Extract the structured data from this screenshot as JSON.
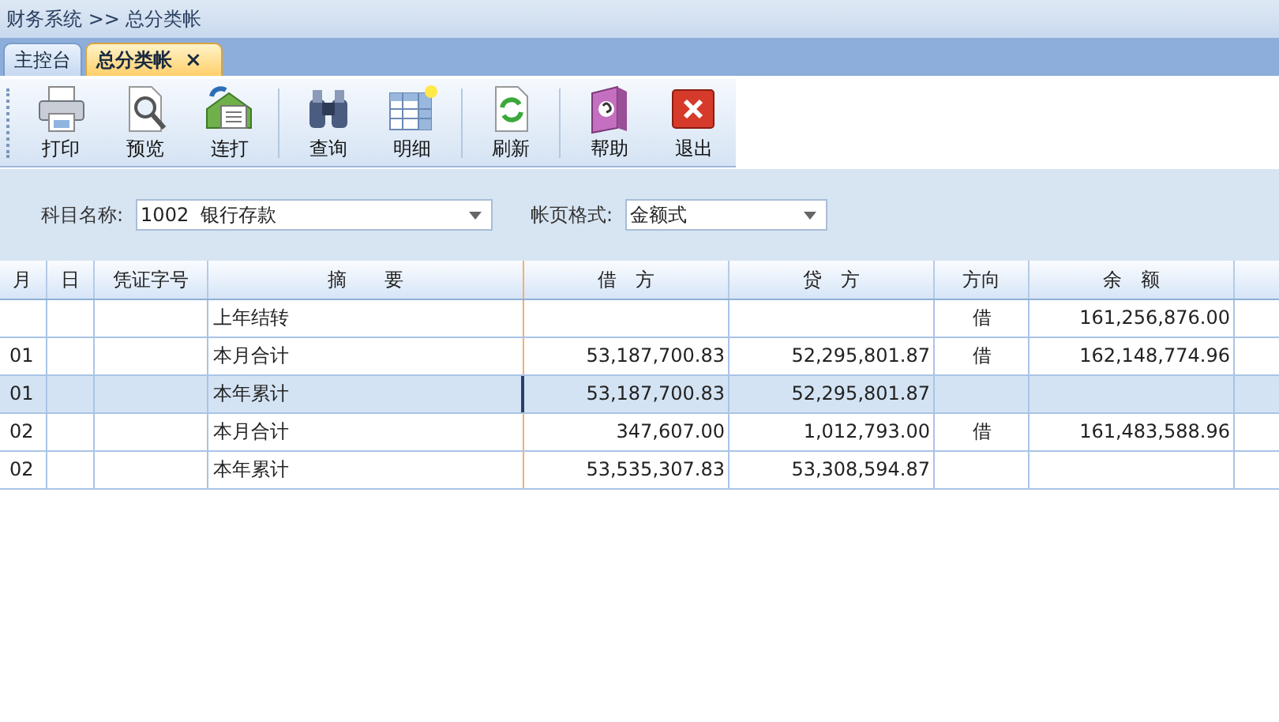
{
  "breadcrumb": "财务系统 >> 总分类帐",
  "tabs": [
    {
      "label": "主控台",
      "selected": false
    },
    {
      "label": "总分类帐",
      "selected": true,
      "close": "×"
    }
  ],
  "toolbar": {
    "groups": [
      [
        {
          "label": "打印"
        },
        {
          "label": "预览"
        },
        {
          "label": "连打"
        }
      ],
      [
        {
          "label": "查询"
        },
        {
          "label": "明细"
        }
      ],
      [
        {
          "label": "刷新"
        }
      ],
      [
        {
          "label": "帮助"
        },
        {
          "label": "退出"
        }
      ]
    ]
  },
  "filters": [
    {
      "label": "科目名称:",
      "value": "1002  银行存款"
    },
    {
      "label": "帐页格式:",
      "value": "金额式"
    }
  ],
  "table": {
    "columns": [
      {
        "label": "月"
      },
      {
        "label": "日"
      },
      {
        "label": "凭证字号"
      },
      {
        "label": "摘　　要"
      },
      {
        "label": "借　方"
      },
      {
        "label": "贷　方"
      },
      {
        "label": "方向"
      },
      {
        "label": "余　额"
      }
    ],
    "rows": [
      {
        "selected": false,
        "cells": [
          "",
          "",
          "",
          "上年结转",
          "",
          "",
          "借",
          "161,256,876.00"
        ]
      },
      {
        "selected": false,
        "cells": [
          "01",
          "",
          "",
          "本月合计",
          "53,187,700.83",
          "52,295,801.87",
          "借",
          "162,148,774.96"
        ]
      },
      {
        "selected": true,
        "cells": [
          "01",
          "",
          "",
          "本年累计",
          "53,187,700.83",
          "52,295,801.87",
          "",
          ""
        ]
      },
      {
        "selected": false,
        "cells": [
          "02",
          "",
          "",
          "本月合计",
          "347,607.00",
          "1,012,793.00",
          "借",
          "161,483,588.96"
        ]
      },
      {
        "selected": false,
        "cells": [
          "02",
          "",
          "",
          "本年累计",
          "53,535,307.83",
          "53,308,594.87",
          "",
          ""
        ]
      }
    ]
  }
}
